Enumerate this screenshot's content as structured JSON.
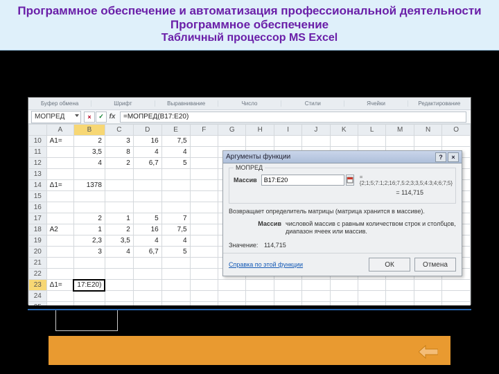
{
  "slide": {
    "title1": "Программное обеспечение и автоматизация профессиональной деятельности",
    "title2": "Программное обеспечение",
    "title3": "Табличный процессор  MS Excel"
  },
  "ribbon_groups": [
    "Буфер обмена",
    "Шрифт",
    "Выравнивание",
    "Число",
    "Стили",
    "Ячейки",
    "Редактирование"
  ],
  "namebox": "МОПРЕД",
  "fx_buttons": {
    "cancel": "×",
    "enter": "✓",
    "fx": "fx"
  },
  "formula_bar": "=МОПРЕД(B17:E20)",
  "columns": [
    "A",
    "B",
    "C",
    "D",
    "E",
    "F",
    "G",
    "H",
    "I",
    "J",
    "K",
    "L",
    "M",
    "N",
    "O"
  ],
  "rows": {
    "10": {
      "A": "A1=",
      "B": "2",
      "C": "3",
      "D": "16",
      "E": "7,5"
    },
    "11": {
      "B": "3,5",
      "C": "8",
      "D": "4",
      "E": "4"
    },
    "12": {
      "B": "4",
      "C": "2",
      "D": "6,7",
      "E": "5"
    },
    "13": {},
    "14": {
      "A": "Δ1=",
      "B": "1378"
    },
    "15": {},
    "16": {},
    "17": {
      "B": "2",
      "C": "1",
      "D": "5",
      "E": "7"
    },
    "18": {
      "A": "A2",
      "B": "1",
      "C": "2",
      "D": "16",
      "E": "7,5"
    },
    "19": {
      "B": "2,3",
      "C": "3,5",
      "D": "4",
      "E": "4"
    },
    "20": {
      "B": "3",
      "C": "4",
      "D": "6,7",
      "E": "5"
    },
    "21": {},
    "22": {},
    "23": {
      "A": "Δ1=",
      "B": "17:E20)"
    },
    "24": {},
    "25": {}
  },
  "dialog": {
    "title": "Аргументы функции",
    "function_name": "МОПРЕД",
    "field_label": "Массив",
    "field_value": "B17:E20",
    "preview_array": "= {2;1;5;7:1;2;16;7,5:2;3;3,5;4:3;4;6;7;5}",
    "result_eq": "= 114,715",
    "description1": "Возвращает определитель матрицы (матрица хранится в массиве).",
    "arg_name": "Массив",
    "arg_desc": "числовой массив с равным количеством строк и столбцов, диапазон ячеек или массив.",
    "value_label": "Значение:",
    "value": "114,715",
    "help_link": "Справка по этой функции",
    "ok": "ОК",
    "cancel": "Отмена"
  }
}
